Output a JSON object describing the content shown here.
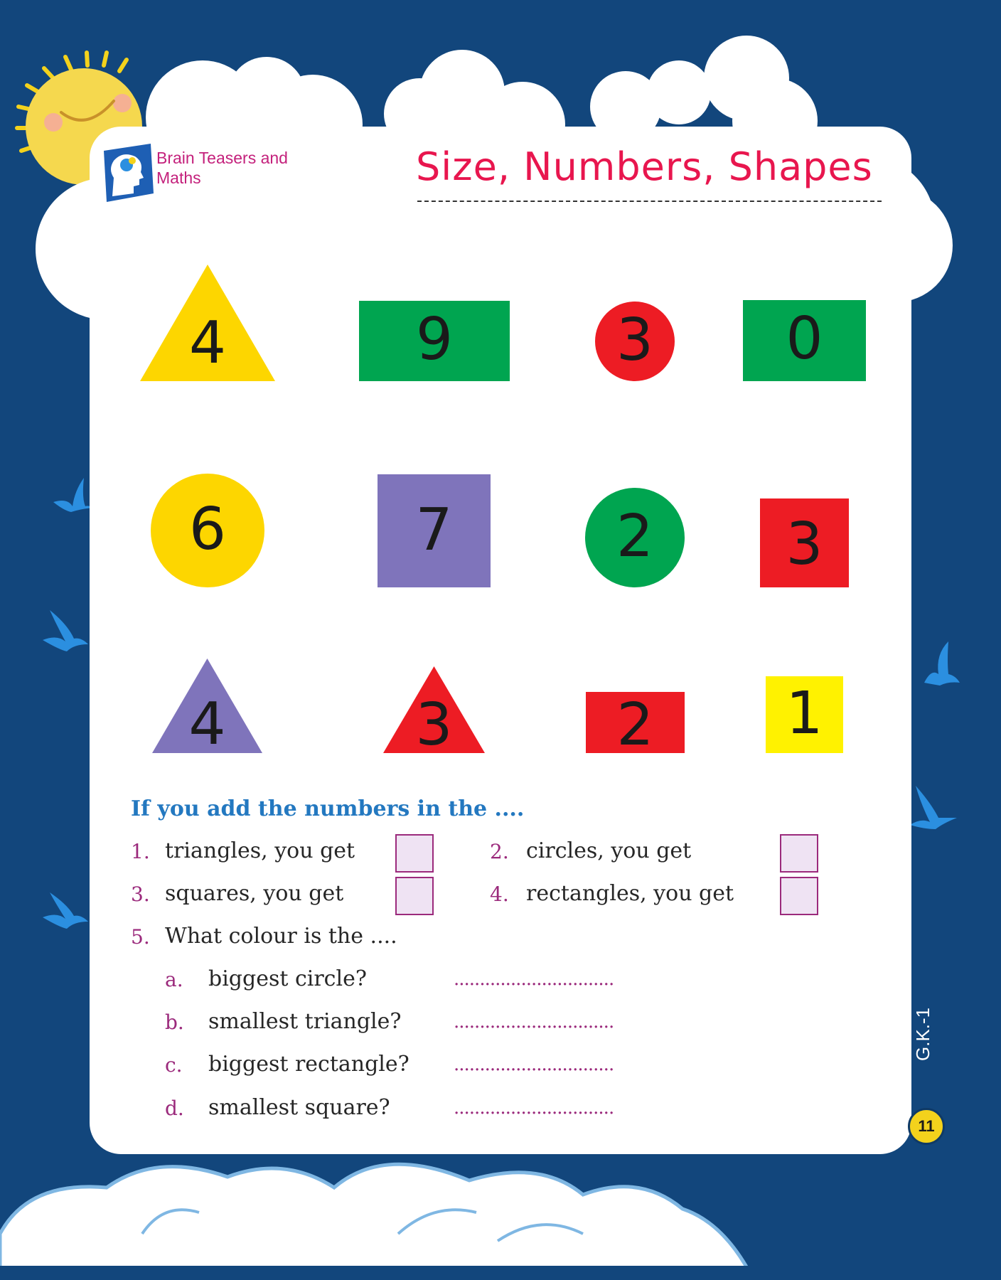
{
  "header": {
    "logo_text_line1": "Brain Teasers and",
    "logo_text_line2": "Maths",
    "title": "Size, Numbers, Shapes"
  },
  "shapes": [
    {
      "shape": "triangle",
      "color": "#fdd600",
      "number": "4"
    },
    {
      "shape": "rectangle",
      "color": "#00a550",
      "number": "9"
    },
    {
      "shape": "circle",
      "color": "#ed1c24",
      "number": "3"
    },
    {
      "shape": "rectangle",
      "color": "#00a550",
      "number": "0"
    },
    {
      "shape": "circle",
      "color": "#fdd600",
      "number": "6"
    },
    {
      "shape": "square",
      "color": "#7f74bb",
      "number": "7"
    },
    {
      "shape": "circle",
      "color": "#00a550",
      "number": "2"
    },
    {
      "shape": "rectangle",
      "color": "#ed1c24",
      "number": "3"
    },
    {
      "shape": "triangle",
      "color": "#7f74bb",
      "number": "4"
    },
    {
      "shape": "triangle",
      "color": "#ed1c24",
      "number": "3"
    },
    {
      "shape": "rectangle",
      "color": "#ed1c24",
      "number": "2"
    },
    {
      "shape": "square",
      "color": "#fff200",
      "number": "1"
    }
  ],
  "questions": {
    "heading": "If you add the numbers in the ....",
    "items": [
      {
        "num": "1.",
        "text": "triangles, you get"
      },
      {
        "num": "2.",
        "text": "circles, you get"
      },
      {
        "num": "3.",
        "text": "squares, you get"
      },
      {
        "num": "4.",
        "text": "rectangles, you get"
      }
    ],
    "q5": {
      "num": "5.",
      "text": "What colour is the ...."
    },
    "sub": [
      {
        "letter": "a.",
        "text": "biggest circle?",
        "blank": "..............................."
      },
      {
        "letter": "b.",
        "text": "smallest triangle?",
        "blank": "..............................."
      },
      {
        "letter": "c.",
        "text": "biggest rectangle?",
        "blank": "..............................."
      },
      {
        "letter": "d.",
        "text": "smallest square?",
        "blank": "..............................."
      }
    ]
  },
  "footer": {
    "class_label": "G.K.-1",
    "page_number": "11"
  },
  "colors": {
    "background": "#12467c",
    "title": "#e8164e",
    "heading": "#2378c0",
    "numbering": "#9b2a7c"
  }
}
